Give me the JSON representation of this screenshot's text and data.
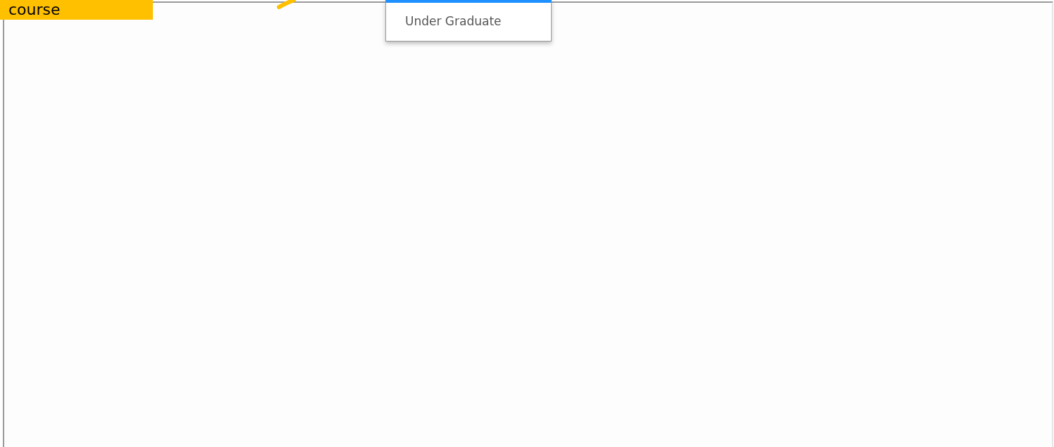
{
  "callout": {
    "text": "course"
  },
  "dropdown": {
    "options": [
      {
        "label": "Under Graduate",
        "selected": false
      }
    ]
  }
}
